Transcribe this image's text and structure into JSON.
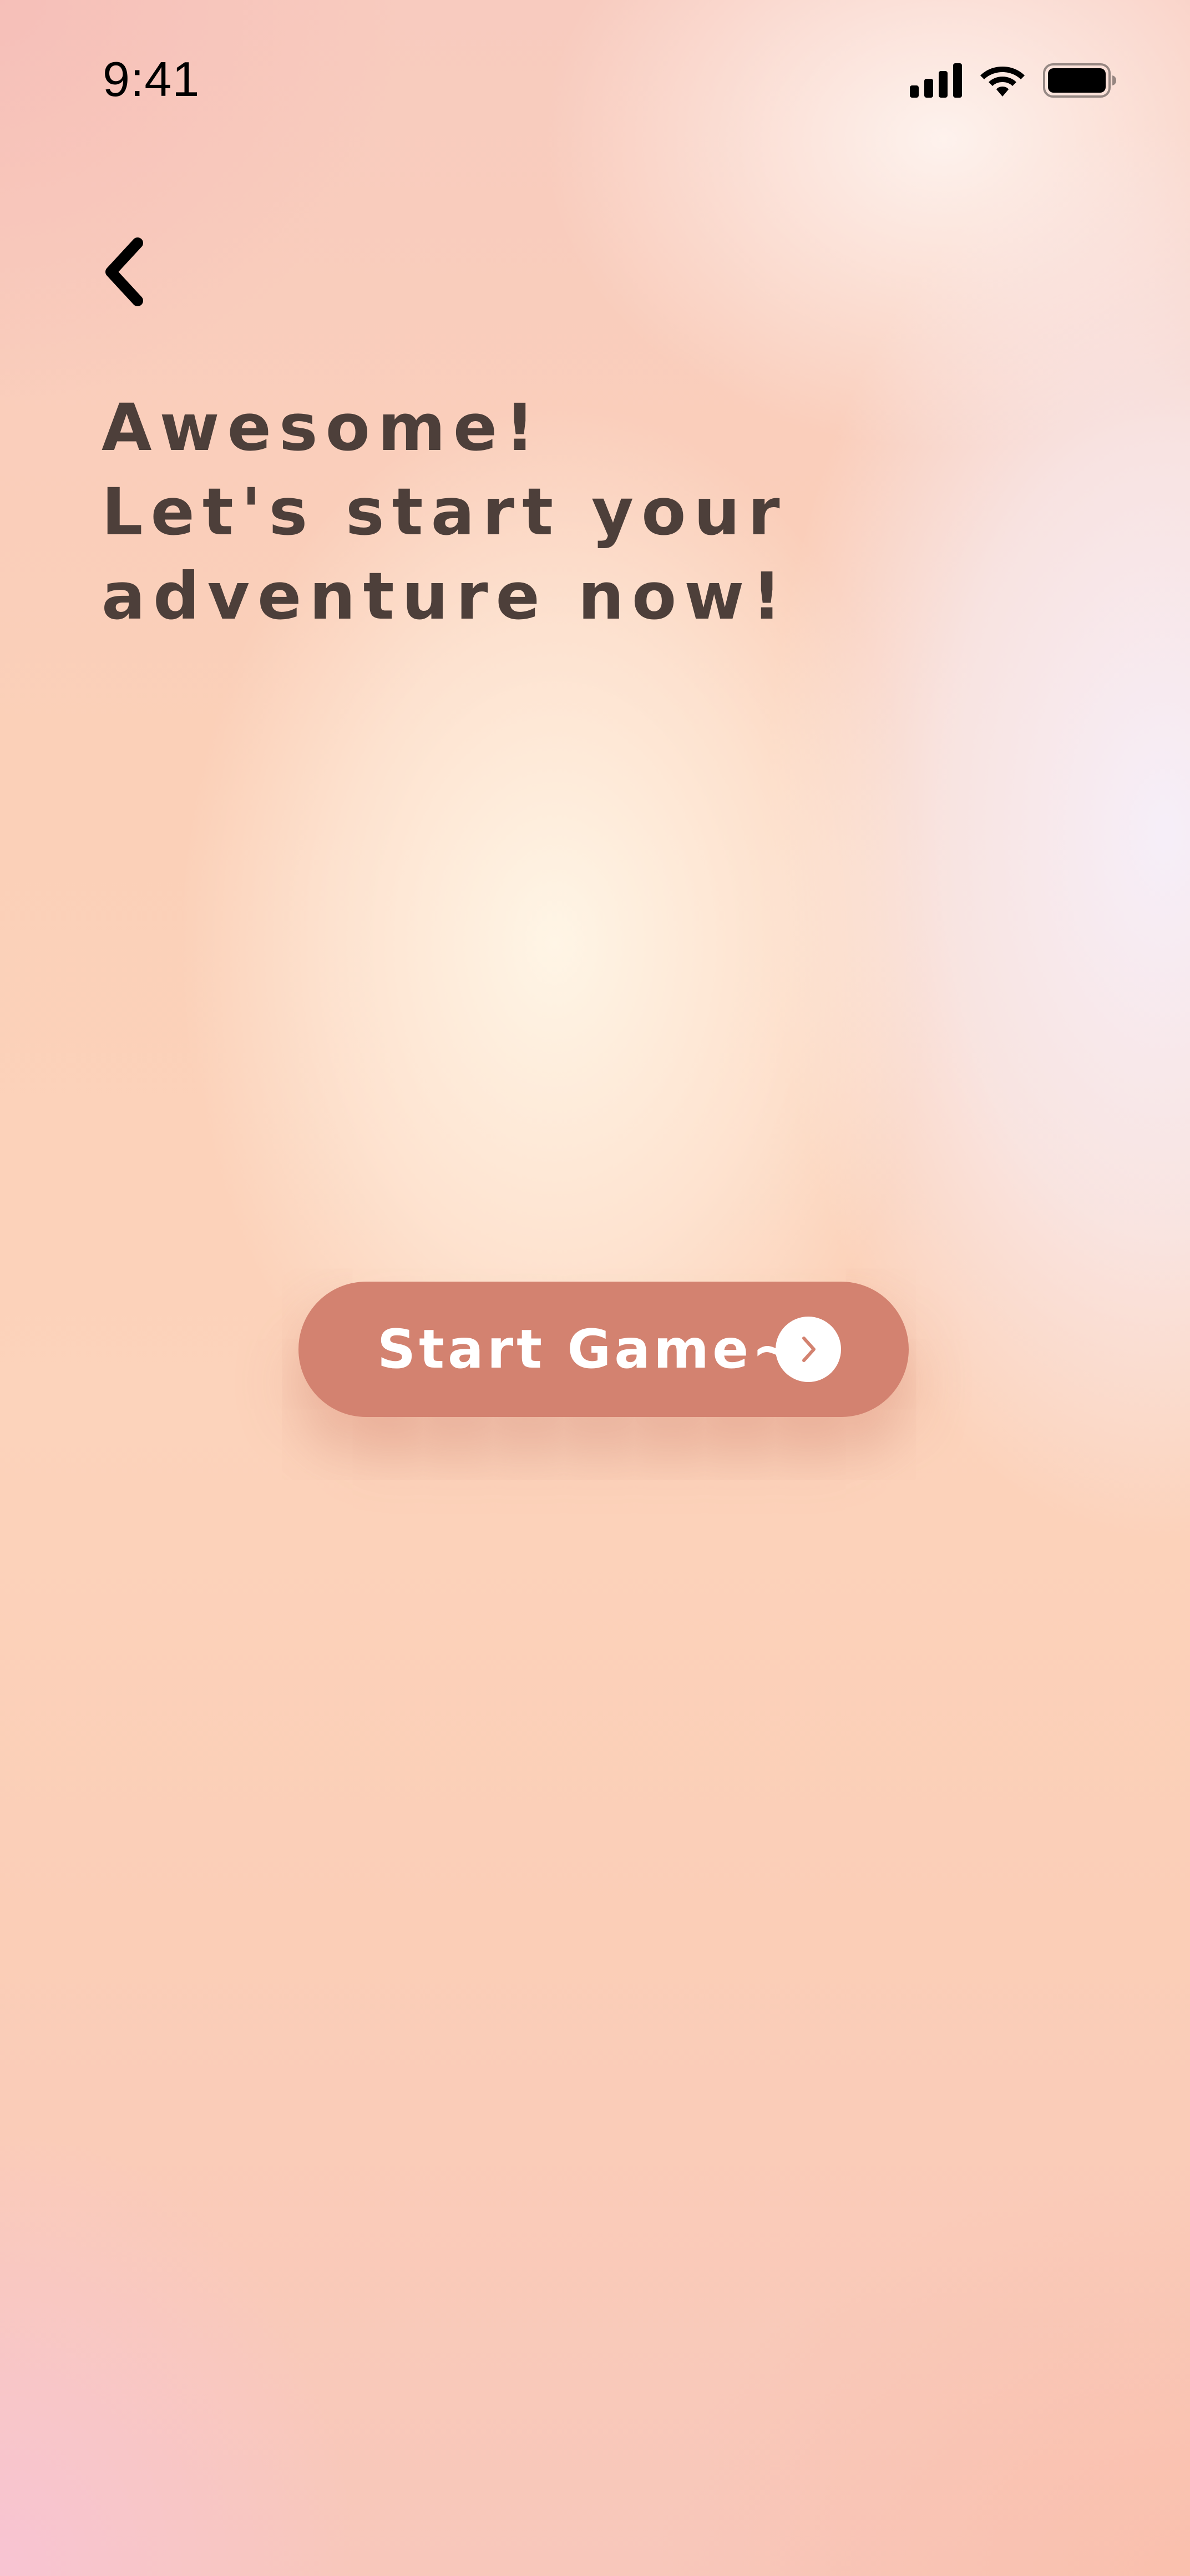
{
  "status_bar": {
    "time": "9:41",
    "signal_icon": "cellular-signal-icon",
    "wifi_icon": "wifi-icon",
    "battery_icon": "battery-full-icon"
  },
  "nav": {
    "back_icon": "chevron-left-icon"
  },
  "heading": {
    "lines": [
      "Awesome!",
      "Let's start your",
      "adventure now!"
    ]
  },
  "start_button": {
    "label": "Start Game~",
    "icon": "chevron-right-icon"
  },
  "colors": {
    "button": "#d38270",
    "heading_text": "#4d3f3a",
    "button_text": "#ffffff"
  }
}
